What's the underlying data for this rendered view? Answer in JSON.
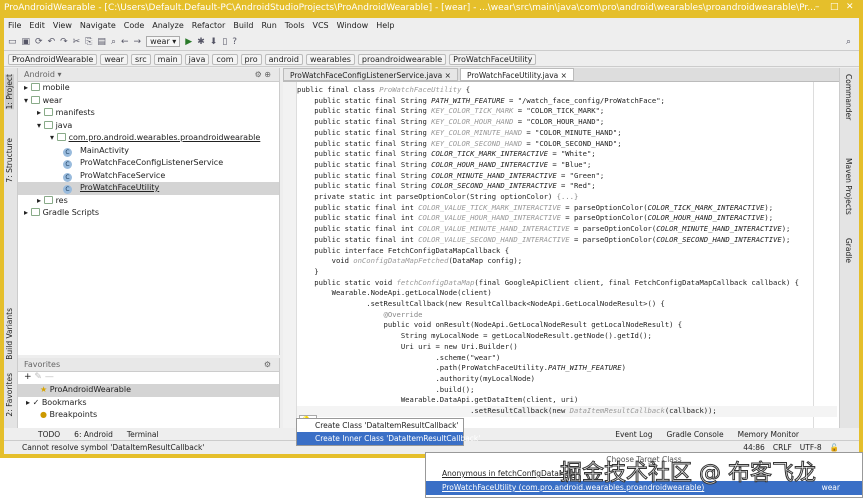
{
  "window": {
    "title": "ProAndroidWearable - [C:\\Users\\Default.Default-PC\\AndroidStudioProjects\\ProAndroidWearable] - [wear] - ...\\wear\\src\\main\\java\\com\\pro\\android\\wearables\\proandroidwearable\\Pr..."
  },
  "menu": [
    "File",
    "Edit",
    "View",
    "Navigate",
    "Code",
    "Analyze",
    "Refactor",
    "Build",
    "Run",
    "Tools",
    "VCS",
    "Window",
    "Help"
  ],
  "toolbar": {
    "run_config": "wear"
  },
  "breadcrumb": [
    "ProAndroidWearable",
    "wear",
    "src",
    "main",
    "java",
    "com",
    "pro",
    "android",
    "wearables",
    "proandroidwearable",
    "ProWatchFaceUtility"
  ],
  "left_tools": [
    "1: Project",
    "7: Structure",
    "Build Variants",
    "2: Favorites"
  ],
  "right_tools": [
    "Commander",
    "Maven Projects",
    "Gradle"
  ],
  "project": {
    "view": "Android",
    "tree": [
      {
        "label": "mobile",
        "depth": 0
      },
      {
        "label": "wear",
        "depth": 0
      },
      {
        "label": "manifests",
        "depth": 1
      },
      {
        "label": "java",
        "depth": 1
      },
      {
        "label": "com.pro.android.wearables.proandroidwearable",
        "depth": 2
      },
      {
        "label": "MainActivity",
        "depth": 3,
        "cls": true
      },
      {
        "label": "ProWatchFaceConfigListenerService",
        "depth": 3,
        "cls": true
      },
      {
        "label": "ProWatchFaceService",
        "depth": 3,
        "cls": true
      },
      {
        "label": "ProWatchFaceUtility",
        "depth": 3,
        "cls": true,
        "selected": true
      },
      {
        "label": "res",
        "depth": 1
      },
      {
        "label": "Gradle Scripts",
        "depth": 0
      }
    ]
  },
  "favorites": {
    "title": "Favorites",
    "items": [
      "ProAndroidWearable",
      "Bookmarks",
      "Breakpoints"
    ]
  },
  "tabs": [
    {
      "label": "ProWatchFaceConfigListenerService.java",
      "active": false
    },
    {
      "label": "ProWatchFaceUtility.java",
      "active": true
    }
  ],
  "code": [
    [
      [
        "public final class ",
        "n"
      ],
      [
        "ProWatchFaceUtility",
        "g"
      ],
      [
        " {",
        "n"
      ]
    ],
    [
      [
        "    public static final String ",
        "n"
      ],
      [
        "PATH_WITH_FEATURE",
        "i"
      ],
      [
        " = \"/watch_face_config/ProWatchFace\";",
        "n"
      ]
    ],
    [
      [
        "    public static final String ",
        "n"
      ],
      [
        "KEY_COLOR_TICK_MARK",
        "g"
      ],
      [
        " = \"COLOR_TICK_MARK\";",
        "n"
      ]
    ],
    [
      [
        "    public static final String ",
        "n"
      ],
      [
        "KEY_COLOR_HOUR_HAND",
        "g"
      ],
      [
        " = \"COLOR_HOUR_HAND\";",
        "n"
      ]
    ],
    [
      [
        "    public static final String ",
        "n"
      ],
      [
        "KEY_COLOR_MINUTE_HAND",
        "g"
      ],
      [
        " = \"COLOR_MINUTE_HAND\";",
        "n"
      ]
    ],
    [
      [
        "    public static final String ",
        "n"
      ],
      [
        "KEY_COLOR_SECOND_HAND",
        "g"
      ],
      [
        " = \"COLOR_SECOND_HAND\";",
        "n"
      ]
    ],
    [
      [
        "    public static final String ",
        "n"
      ],
      [
        "COLOR_TICK_MARK_INTERACTIVE",
        "i"
      ],
      [
        " = \"White\";",
        "n"
      ]
    ],
    [
      [
        "    public static final String ",
        "n"
      ],
      [
        "COLOR_HOUR_HAND_INTERACTIVE",
        "i"
      ],
      [
        " = \"Blue\";",
        "n"
      ]
    ],
    [
      [
        "    public static final String ",
        "n"
      ],
      [
        "COLOR_MINUTE_HAND_INTERACTIVE",
        "i"
      ],
      [
        " = \"Green\";",
        "n"
      ]
    ],
    [
      [
        "    public static final String ",
        "n"
      ],
      [
        "COLOR_SECOND_HAND_INTERACTIVE",
        "i"
      ],
      [
        " = \"Red\";",
        "n"
      ]
    ],
    [
      [
        "    private static int parseOptionColor(String optionColor) ",
        "n"
      ],
      [
        "{...}",
        "a"
      ]
    ],
    [
      [
        "    public static final int ",
        "n"
      ],
      [
        "COLOR_VALUE_TICK_MARK_INTERACTIVE",
        "g"
      ],
      [
        " = parseOptionColor(",
        "n"
      ],
      [
        "COLOR_TICK_MARK_INTERACTIVE",
        "i"
      ],
      [
        ");",
        "n"
      ]
    ],
    [
      [
        "    public static final int ",
        "n"
      ],
      [
        "COLOR_VALUE_HOUR_HAND_INTERACTIVE",
        "g"
      ],
      [
        " = parseOptionColor(",
        "n"
      ],
      [
        "COLOR_HOUR_HAND_INTERACTIVE",
        "i"
      ],
      [
        ");",
        "n"
      ]
    ],
    [
      [
        "    public static final int ",
        "n"
      ],
      [
        "COLOR_VALUE_MINUTE_HAND_INTERACTIVE",
        "g"
      ],
      [
        " = parseOptionColor(",
        "n"
      ],
      [
        "COLOR_MINUTE_HAND_INTERACTIVE",
        "i"
      ],
      [
        ");",
        "n"
      ]
    ],
    [
      [
        "    public static final int ",
        "n"
      ],
      [
        "COLOR_VALUE_SECOND_HAND_INTERACTIVE",
        "g"
      ],
      [
        " = parseOptionColor(",
        "n"
      ],
      [
        "COLOR_SECOND_HAND_INTERACTIVE",
        "i"
      ],
      [
        ");",
        "n"
      ]
    ],
    [
      [
        "    public interface FetchConfigDataMapCallback {",
        "n"
      ]
    ],
    [
      [
        "        void ",
        "n"
      ],
      [
        "onConfigDataMapFetched",
        "g"
      ],
      [
        "(DataMap config);",
        "n"
      ]
    ],
    [
      [
        "    }",
        "n"
      ]
    ],
    [
      [
        "    public static void ",
        "n"
      ],
      [
        "fetchConfigDataMap",
        "g"
      ],
      [
        "(final GoogleApiClient client, final FetchConfigDataMapCallback callback) {",
        "n"
      ]
    ],
    [
      [
        "        Wearable.NodeApi.getLocalNode(client)",
        "n"
      ]
    ],
    [
      [
        "                .setResultCallback(new ResultCallback<NodeApi.GetLocalNodeResult>() {",
        "n"
      ]
    ],
    [
      [
        "                    ",
        "n"
      ],
      [
        "@Override",
        "a"
      ]
    ],
    [
      [
        "                    public void onResult(NodeApi.GetLocalNodeResult getLocalNodeResult) {",
        "n"
      ]
    ],
    [
      [
        "                        String myLocalNode = getLocalNodeResult.getNode().getId();",
        "n"
      ]
    ],
    [
      [
        "                        Uri uri = new Uri.Builder()",
        "n"
      ]
    ],
    [
      [
        "                                .scheme(\"wear\")",
        "n"
      ]
    ],
    [
      [
        "                                .path(ProWatchFaceUtility.",
        "n"
      ],
      [
        "PATH_WITH_FEATURE",
        "i"
      ],
      [
        ")",
        "n"
      ]
    ],
    [
      [
        "                                .authority(myLocalNode)",
        "n"
      ]
    ],
    [
      [
        "                                .build();",
        "n"
      ]
    ],
    [
      [
        "                        Wearable.DataApi.getDataItem(client, uri)",
        "n"
      ]
    ],
    [
      [
        "                                        .setResultCallback(new ",
        "n"
      ],
      [
        "DataItemResultCallback",
        "g"
      ],
      [
        "(callback));",
        "n"
      ]
    ]
  ],
  "quickfix": [
    "Create Class 'DataItemResultCallback'",
    "Create Inner Class 'DataItemResultCallback'"
  ],
  "bottom_tools": [
    "TODO",
    "6: Android",
    "Terminal",
    "Event Log",
    "Gradle Console",
    "Memory Monitor"
  ],
  "status": {
    "message": "Cannot resolve symbol 'DataItemResultCallback'",
    "position": "44:86",
    "line_sep": "CRLF",
    "encoding": "UTF-8"
  },
  "popup": {
    "header": "Choose Target Class",
    "items": [
      {
        "label": "Anonymous in fetchConfigDataMap",
        "selected": false
      },
      {
        "label": "ProWatchFaceUtility (com.pro.android.wearables.proandroidwearable)",
        "module": "wear",
        "selected": true
      }
    ]
  },
  "watermark": "掘金技术社区 @ 布客飞龙",
  "colors": {
    "window_frame": "#e5bf2b",
    "selection": "#3a6fc6"
  }
}
